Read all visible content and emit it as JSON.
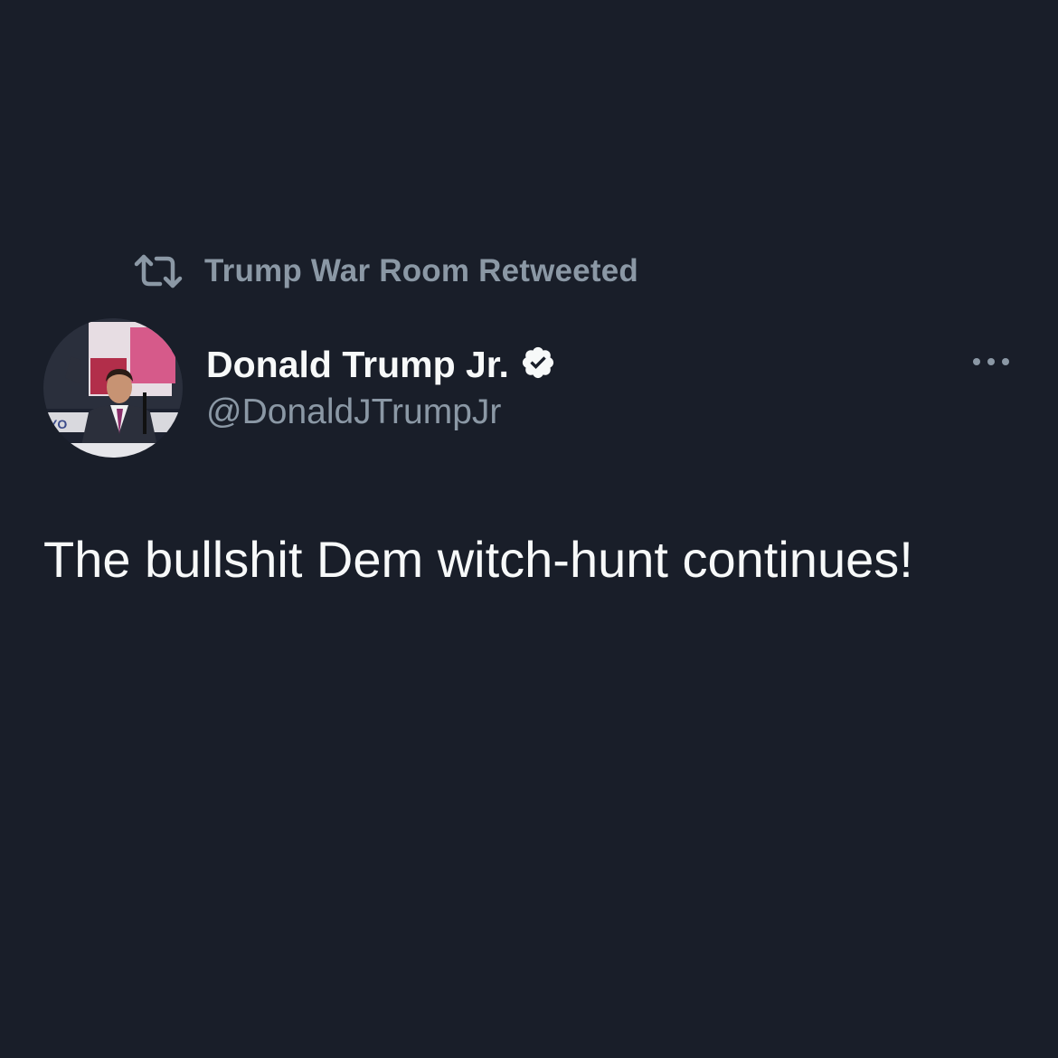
{
  "retweet": {
    "icon": "retweet-icon",
    "label": "Trump War Room Retweeted"
  },
  "tweet": {
    "author": {
      "display_name": "Donald Trump Jr.",
      "handle": "@DonaldJTrumpJr",
      "verified_icon": "verified-badge-icon",
      "avatar": "profile-photo"
    },
    "more_icon": "more-options-icon",
    "text": "The bullshit Dem witch-hunt continues!"
  },
  "colors": {
    "background": "#191e29",
    "primary_text": "#f7f9f9",
    "secondary_text": "#8b98a5"
  }
}
